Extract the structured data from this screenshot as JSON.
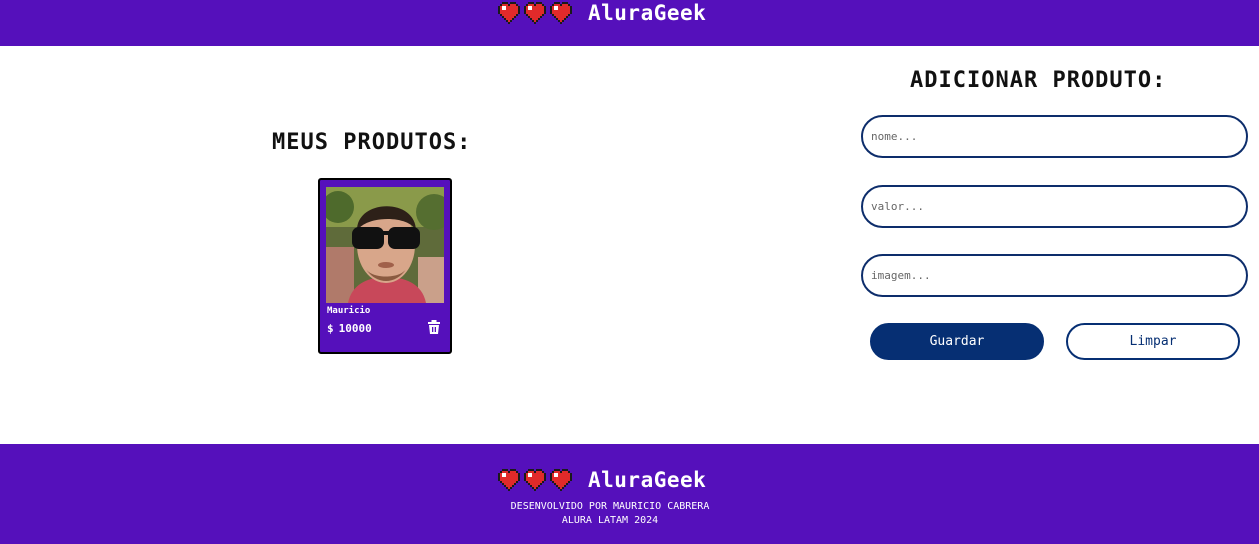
{
  "app": {
    "name": "AluraGeek"
  },
  "colors": {
    "brand_purple": "#5510bb",
    "primary_blue": "#062f73",
    "heart_red": "#e12a2a"
  },
  "icons": {
    "heart": "heart-icon",
    "delete": "trash-icon"
  },
  "products_section": {
    "title": "MEUS PRODUTOS:",
    "items": [
      {
        "name": "Mauricio",
        "currency": "$",
        "price": "10000"
      }
    ]
  },
  "form": {
    "title": "ADICIONAR PRODUTO:",
    "name_placeholder": "nome...",
    "name_value": "",
    "value_placeholder": "valor...",
    "value_value": "",
    "image_placeholder": "imagem...",
    "image_value": "",
    "save_label": "Guardar",
    "clear_label": "Limpar"
  },
  "footer": {
    "credit_line1": "DESENVOLVIDO POR MAURICIO CABRERA",
    "credit_line2": "ALURA LATAM 2024"
  }
}
